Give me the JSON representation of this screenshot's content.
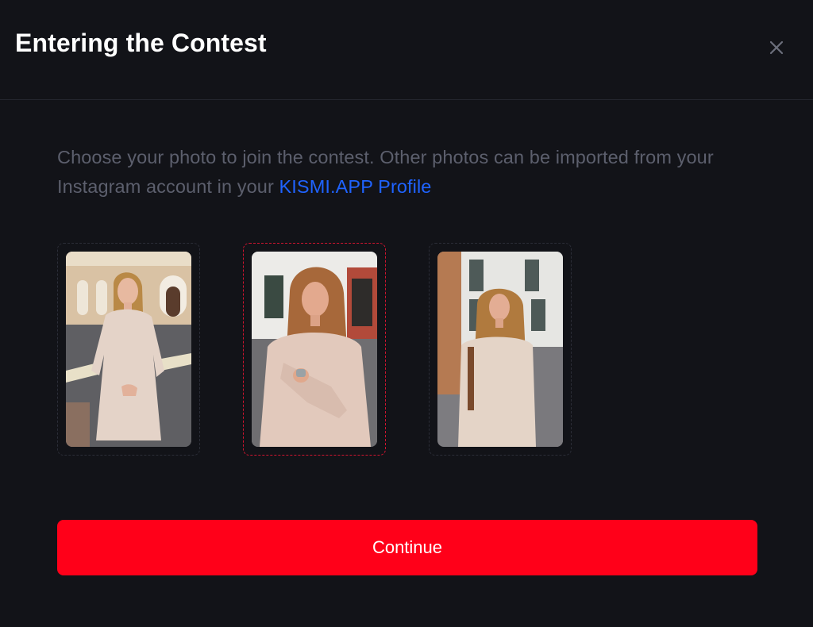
{
  "modal": {
    "title": "Entering the Contest",
    "close_icon": "close-icon"
  },
  "description": {
    "text": "Choose your photo to join the contest. Other photos can be imported from your Instagram account in your ",
    "link_label": "KISMI.APP Profile"
  },
  "photos": [
    {
      "name": "photo-option-1",
      "selected": false
    },
    {
      "name": "photo-option-2",
      "selected": true
    },
    {
      "name": "photo-option-3",
      "selected": false
    }
  ],
  "continue_label": "Continue",
  "colors": {
    "background": "#121318",
    "accent": "#ff0019",
    "link": "#1f63ff",
    "selected_border": "#d0142f",
    "muted_text": "#5c5f6d"
  }
}
